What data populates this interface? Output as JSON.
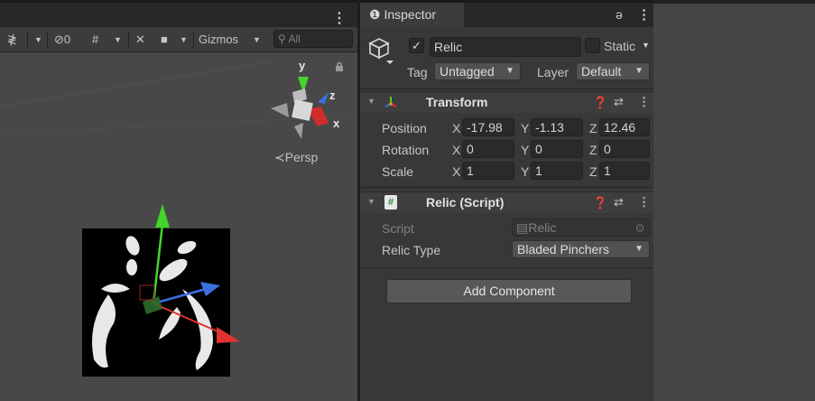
{
  "scene": {
    "toolbar": {
      "hidden_count": "0",
      "gizmos_label": "Gizmos",
      "search_placeholder": "All"
    },
    "gizmo": {
      "y_label": "y",
      "z_label": "z",
      "x_label": "x",
      "persp_label": "Persp"
    }
  },
  "inspector": {
    "tab_label": "Inspector",
    "object": {
      "active": true,
      "name": "Relic",
      "static_label": "Static",
      "tag_label": "Tag",
      "tag_value": "Untagged",
      "layer_label": "Layer",
      "layer_value": "Default"
    },
    "transform": {
      "title": "Transform",
      "position": {
        "label": "Position",
        "x": "-17.98",
        "y": "-1.13",
        "z": "12.46"
      },
      "rotation": {
        "label": "Rotation",
        "x": "0",
        "y": "0",
        "z": "0"
      },
      "scale": {
        "label": "Scale",
        "x": "1",
        "y": "1",
        "z": "1"
      },
      "axis_x": "X",
      "axis_y": "Y",
      "axis_z": "Z"
    },
    "script_component": {
      "title": "Relic (Script)",
      "script_label": "Script",
      "script_value": "Relic",
      "relic_type_label": "Relic Type",
      "relic_type_value": "Bladed Pinchers"
    },
    "add_component_label": "Add Component"
  },
  "colors": {
    "axis_x": "#e03232",
    "axis_y": "#44d42c",
    "axis_z": "#3b6fe0"
  }
}
